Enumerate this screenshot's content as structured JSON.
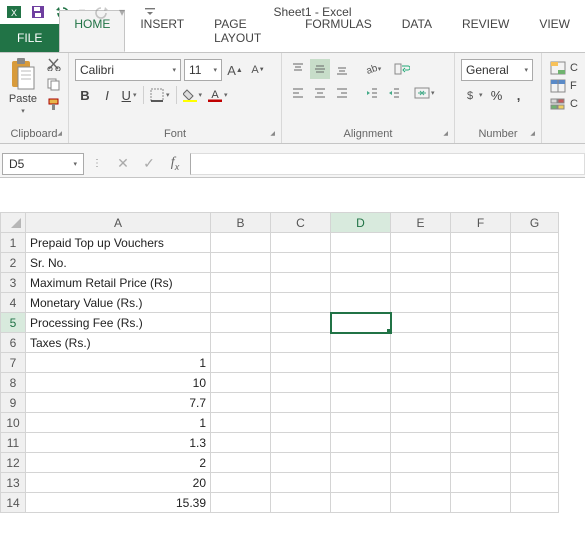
{
  "title": "Sheet1 - Excel",
  "tabs": {
    "file": "FILE",
    "list": [
      "HOME",
      "INSERT",
      "PAGE LAYOUT",
      "FORMULAS",
      "DATA",
      "REVIEW",
      "VIEW"
    ],
    "active": "HOME"
  },
  "ribbon": {
    "clipboard": {
      "label": "Clipboard",
      "paste": "Paste"
    },
    "font": {
      "label": "Font",
      "name": "Calibri",
      "size": "11"
    },
    "alignment": {
      "label": "Alignment"
    },
    "number": {
      "label": "Number",
      "format": "General"
    }
  },
  "namebox": "D5",
  "columns": [
    "A",
    "B",
    "C",
    "D",
    "E",
    "F",
    "G"
  ],
  "active_col": "D",
  "active_row": 5,
  "row_count": 14,
  "cells": {
    "A1": "Prepaid Top up Vouchers",
    "A2": "Sr. No.",
    "A3": "Maximum Retail Price (Rs)",
    "A4": "Monetary Value (Rs.)",
    "A5": "Processing Fee (Rs.)",
    "A6": "Taxes (Rs.)",
    "A7": "1",
    "A8": "10",
    "A9": "7.7",
    "A10": "1",
    "A11": "1.3",
    "A12": "2",
    "A13": "20",
    "A14": "15.39"
  },
  "numeric_rows": [
    7,
    8,
    9,
    10,
    11,
    12,
    13,
    14
  ]
}
